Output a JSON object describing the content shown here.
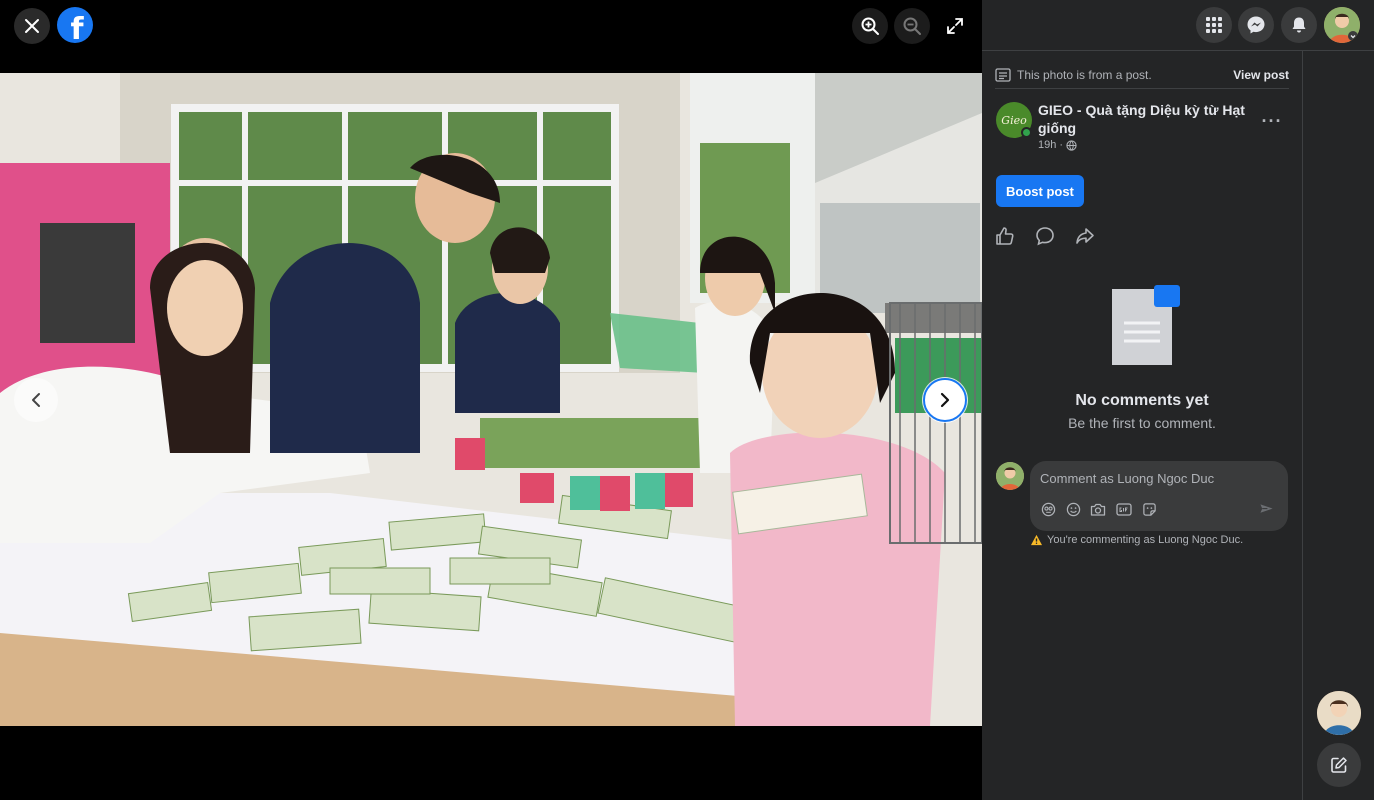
{
  "viewer": {
    "close_icon": "close-icon",
    "logo_icon": "facebook-logo",
    "logo_letter": "f",
    "zoom_in_icon": "zoom-in-icon",
    "zoom_out_icon": "zoom-out-icon",
    "fullscreen_icon": "fullscreen-icon",
    "prev_icon": "chevron-left-icon",
    "next_icon": "chevron-right-icon"
  },
  "header": {
    "menu_icon": "grid-menu-icon",
    "messenger_icon": "messenger-icon",
    "notifications_icon": "bell-icon",
    "profile_icon": "profile-avatar"
  },
  "post": {
    "from_post_text": "This photo is from a post.",
    "view_post_label": "View post",
    "page_name": "GIEO - Quà tặng Diệu kỳ từ Hạt giống",
    "avatar_text": "Gieo",
    "time": "19h",
    "audience_icon": "globe-icon",
    "more_label": "···",
    "boost_label": "Boost post",
    "actions": [
      "like-icon",
      "comment-icon",
      "share-icon"
    ]
  },
  "comments": {
    "empty_title": "No comments yet",
    "empty_subtitle": "Be the first to comment.",
    "input_placeholder": "Comment as Luong Ngoc Duc",
    "tool_icons": [
      "avatar-sticker-icon",
      "emoji-icon",
      "camera-icon",
      "gif-icon",
      "sticker-icon"
    ],
    "send_icon": "send-icon",
    "warning_text": "You're commenting as Luong Ngoc Duc."
  },
  "colors": {
    "accent": "#1877f2",
    "panel_bg": "#242526",
    "online": "#31a24c",
    "warning": "#f7b928"
  }
}
